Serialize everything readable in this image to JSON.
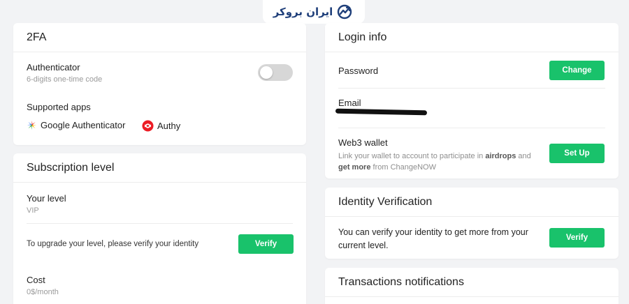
{
  "brand": {
    "logo_text": "ایران بروکر"
  },
  "twofa": {
    "title": "2FA",
    "authenticator_label": "Authenticator",
    "authenticator_sub": "6-digits one-time code",
    "supported_label": "Supported apps",
    "apps": [
      {
        "name": "Google Authenticator",
        "icon": "google-authenticator-icon"
      },
      {
        "name": "Authy",
        "icon": "authy-icon"
      }
    ]
  },
  "subscription": {
    "title": "Subscription level",
    "your_level_label": "Your level",
    "your_level_value": "VIP",
    "upgrade_text": "To upgrade your level, please verify your identity",
    "verify_button": "Verify",
    "cost_label": "Cost",
    "cost_value": "0$/month"
  },
  "login": {
    "title": "Login info",
    "password_label": "Password",
    "change_button": "Change",
    "email_label": "Email",
    "web3_label": "Web3 wallet",
    "web3_desc_1": "Link your wallet to account to participate in ",
    "web3_desc_bold_1": "airdrops",
    "web3_desc_2": " and ",
    "web3_desc_bold_2": "get more",
    "web3_desc_3": " from ChangeNOW",
    "setup_button": "Set Up"
  },
  "identity": {
    "title": "Identity Verification",
    "text": "You can verify your identity to get more from your current level.",
    "verify_button": "Verify"
  },
  "transactions": {
    "title": "Transactions notifications"
  },
  "colors": {
    "accent": "#19c26b",
    "brand": "#1f3f7a",
    "background": "#f2f3f5"
  }
}
